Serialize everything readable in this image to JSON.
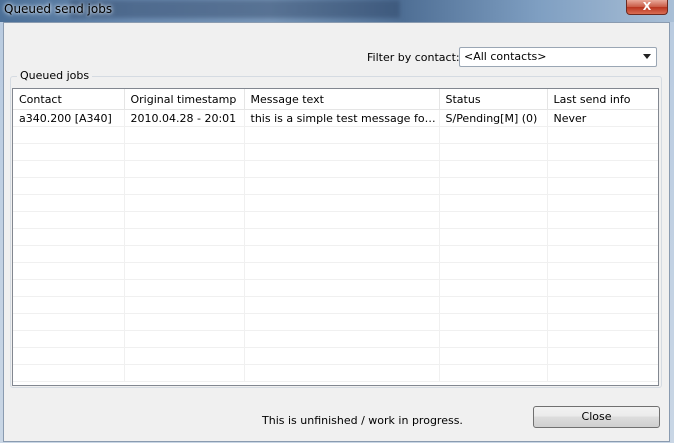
{
  "window": {
    "title": "Queued send jobs",
    "close_glyph": "X"
  },
  "filter": {
    "label": "Filter by contact:",
    "selected": "<All contacts>"
  },
  "group": {
    "title": "Queued jobs"
  },
  "table": {
    "columns": [
      "Contact",
      "Original timestamp",
      "Message text",
      "Status",
      "Last send info"
    ],
    "rows": [
      [
        "a340.200 [A340]",
        "2010.04.28 - 20:01",
        "this is a simple test message for se...",
        "S/Pending[M] (0)",
        "Never"
      ]
    ]
  },
  "footer": {
    "status": "This is unfinished / work in progress.",
    "close_label": "Close"
  }
}
